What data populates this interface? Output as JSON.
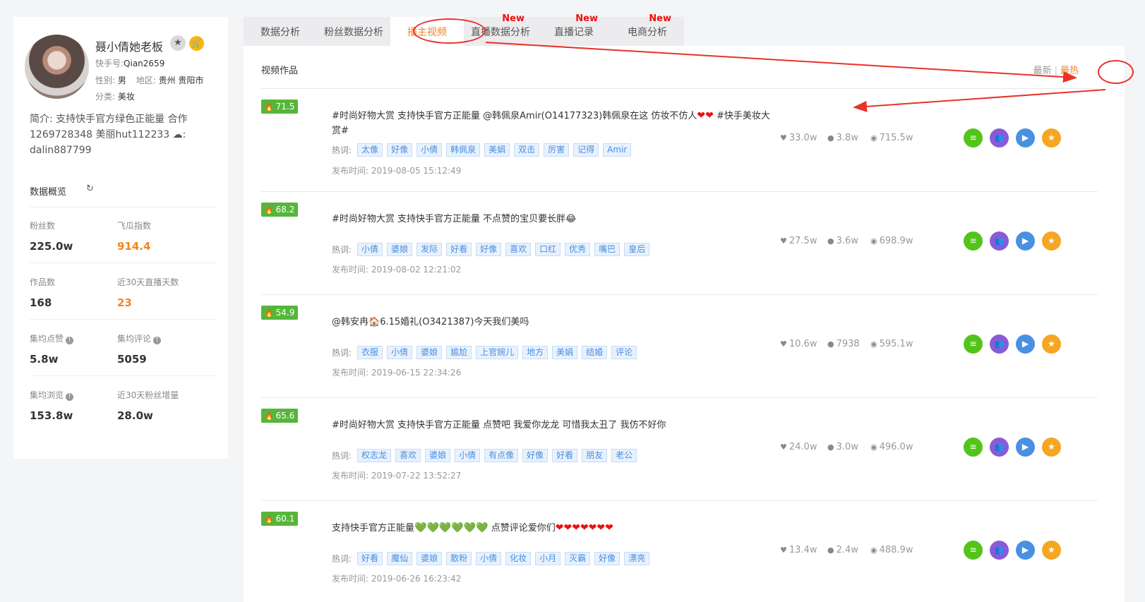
{
  "profile": {
    "name": "聂小倩她老板",
    "kuaishou_label": "快手号:",
    "kuaishou_id": "Qian2659",
    "gender_label": "性别:",
    "gender": "男",
    "region_label": "地区:",
    "region": "贵州 贵阳市",
    "category_label": "分类:",
    "category": "美妆",
    "bio": "简介: 支持快手官方绿色正能量 合作1269728348 美丽hut112233 ☁: dalin887799"
  },
  "overview": {
    "title": "数据概览",
    "stats": [
      {
        "label": "粉丝数",
        "value": "225.0w",
        "highlight": false,
        "info": false
      },
      {
        "label": "飞瓜指数",
        "value": "914.4",
        "highlight": true,
        "info": false
      },
      {
        "label": "作品数",
        "value": "168",
        "highlight": false,
        "info": false
      },
      {
        "label": "近30天直播天数",
        "value": "23",
        "highlight": true,
        "info": false
      },
      {
        "label": "集均点赞",
        "value": "5.8w",
        "highlight": false,
        "info": true
      },
      {
        "label": "集均评论",
        "value": "5059",
        "highlight": false,
        "info": true
      },
      {
        "label": "集均浏览",
        "value": "153.8w",
        "highlight": false,
        "info": true
      },
      {
        "label": "近30天粉丝增量",
        "value": "28.0w",
        "highlight": false,
        "info": false
      }
    ]
  },
  "tabs": [
    {
      "label": "数据分析",
      "new": ""
    },
    {
      "label": "粉丝数据分析",
      "new": ""
    },
    {
      "label": "播主视频",
      "new": ""
    },
    {
      "label": "直播数据分析",
      "new": "New"
    },
    {
      "label": "直播记录",
      "new": "New"
    },
    {
      "label": "电商分析",
      "new": "New"
    }
  ],
  "main": {
    "title": "视频作品",
    "sort_latest": "最新",
    "sort_hot": "最热",
    "hotword_label": "热词:",
    "pub_label": "发布时间:"
  },
  "videos": [
    {
      "score": "71.5",
      "title": "#时尚好物大赏 支持快手官方正能量 @韩佩泉Amir(O14177323)韩佩泉在这 仿妆不仿人",
      "title_suffix_red": "❤❤",
      "title_tail": " #快手美妆大赏#",
      "tags": [
        "太像",
        "好像",
        "小倩",
        "韩佩泉",
        "美娟",
        "双击",
        "厉害",
        "记得",
        "Amir"
      ],
      "time": "2019-08-05 15:12:49",
      "likes": "33.0w",
      "comments": "3.8w",
      "views": "715.5w"
    },
    {
      "score": "68.2",
      "title": "#时尚好物大赏 支持快手官方正能量 不点赞的宝贝要长胖",
      "title_suffix_emoji": "😂",
      "tags": [
        "小倩",
        "婆娘",
        "发际",
        "好看",
        "好像",
        "喜欢",
        "口红",
        "优秀",
        "嘴巴",
        "皇后"
      ],
      "time": "2019-08-02 12:21:02",
      "likes": "27.5w",
      "comments": "3.6w",
      "views": "698.9w"
    },
    {
      "score": "54.9",
      "title_prefix": "@韩安冉",
      "title_prefix_emoji": "🏠",
      "title": "6.15婚礼(O3421387)今天我们美吗",
      "tags": [
        "衣服",
        "小倩",
        "婆娘",
        "尴尬",
        "上官婉儿",
        "地方",
        "美娟",
        "结婚",
        "评论"
      ],
      "time": "2019-06-15 22:34:26",
      "likes": "10.6w",
      "comments": "7938",
      "views": "595.1w"
    },
    {
      "score": "65.6",
      "title": "#时尚好物大赏 支持快手官方正能量 点赞吧 我爱你龙龙 可惜我太丑了 我仿不好你",
      "tags": [
        "权志龙",
        "喜欢",
        "婆娘",
        "小倩",
        "有点像",
        "好像",
        "好看",
        "朋友",
        "老公"
      ],
      "time": "2019-07-22 13:52:27",
      "likes": "24.0w",
      "comments": "3.0w",
      "views": "496.0w"
    },
    {
      "score": "60.1",
      "title": "支持快手官方正能量",
      "title_green": "💚💚💚💚💚💚",
      "title_mid": " 点赞评论爱你们",
      "title_suffix_red": "❤❤❤❤❤❤❤",
      "tags": [
        "好看",
        "魔仙",
        "婆娘",
        "散粉",
        "小倩",
        "化妆",
        "小月",
        "灭霸",
        "好像",
        "漂亮"
      ],
      "time": "2019-06-26 16:23:42",
      "likes": "13.4w",
      "comments": "2.4w",
      "views": "488.9w"
    }
  ],
  "colors": {
    "accent": "#f5841f",
    "score_green": "#56b63a",
    "tag_blue": "#4a90e2",
    "annotation_red": "#e8322a"
  }
}
